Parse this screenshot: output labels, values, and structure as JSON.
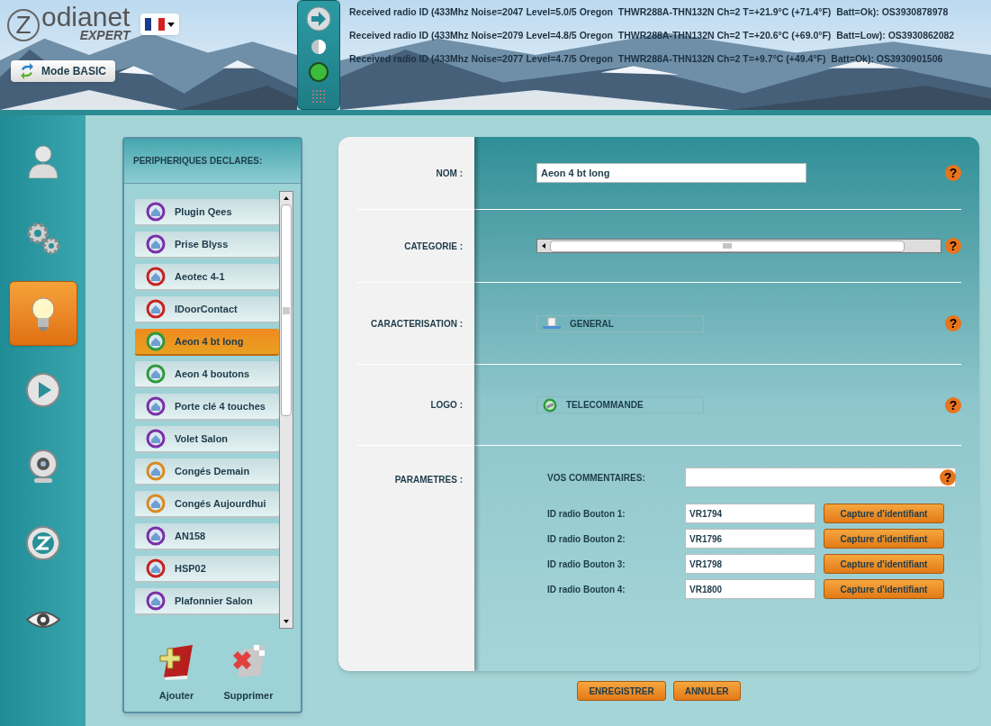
{
  "header": {
    "logo": {
      "letter": "Z",
      "name": "odianet",
      "edition": "EXPERT"
    },
    "mode_button": "Mode BASIC",
    "log_lines": [
      "Received radio ID (433Mhz Noise=2047 Level=5.0/5 Oregon  THWR288A-THN132N Ch=2 T=+21.9°C (+71.4°F)  Batt=Ok): OS3930878978",
      "Received radio ID (433Mhz Noise=2079 Level=4.8/5 Oregon  THWR288A-THN132N Ch=2 T=+20.6°C (+69.0°F)  Batt=Low): OS3930862082",
      "Received radio ID (433Mhz Noise=2077 Level=4.7/5 Oregon  THWR288A-THN132N Ch=2 T=+9.7°C (+49.4°F)  Batt=Ok): OS3930901506"
    ]
  },
  "nav": [
    {
      "kind": "user",
      "selected": false
    },
    {
      "kind": "gears",
      "selected": false
    },
    {
      "kind": "bulb",
      "selected": true
    },
    {
      "kind": "play",
      "selected": false
    },
    {
      "kind": "webcam",
      "selected": false
    },
    {
      "kind": "zlogo",
      "selected": false
    },
    {
      "kind": "eye",
      "selected": false
    }
  ],
  "devices": {
    "title": "PERIPHERIQUES DECLARES:",
    "items": [
      {
        "name": "Plugin Qees",
        "color": "#7b2fa8",
        "selected": false
      },
      {
        "name": "Prise Blyss",
        "color": "#7b2fa8",
        "selected": false
      },
      {
        "name": "Aeotec 4-1",
        "color": "#c8231e",
        "selected": false
      },
      {
        "name": "IDoorContact",
        "color": "#c8231e",
        "selected": false
      },
      {
        "name": "Aeon 4 bt long",
        "color": "#2e9a3a",
        "selected": true
      },
      {
        "name": "Aeon 4 boutons",
        "color": "#2e9a3a",
        "selected": false
      },
      {
        "name": "Porte clé 4 touches",
        "color": "#7b2fa8",
        "selected": false
      },
      {
        "name": "Volet Salon",
        "color": "#7b2fa8",
        "selected": false
      },
      {
        "name": "Congés Demain",
        "color": "#d98a1e",
        "selected": false
      },
      {
        "name": "Congés Aujourdhui",
        "color": "#d98a1e",
        "selected": false
      },
      {
        "name": "AN158",
        "color": "#7b2fa8",
        "selected": false
      },
      {
        "name": "HSP02",
        "color": "#c8231e",
        "selected": false
      },
      {
        "name": "Plafonnier Salon",
        "color": "#7b2fa8",
        "selected": false
      }
    ],
    "actions": [
      {
        "kind": "add",
        "label": "Ajouter"
      },
      {
        "kind": "delete",
        "label": "Supprimer"
      }
    ]
  },
  "form": {
    "rows": [
      {
        "kind": "text",
        "label": "NOM :",
        "value": "Aeon 4 bt long",
        "help": "?"
      },
      {
        "kind": "scroll",
        "label": "CATEGORIE :",
        "help": "?"
      },
      {
        "kind": "characterisation",
        "label": "CARACTERISATION :",
        "value": "GENERAL",
        "help": "?"
      },
      {
        "kind": "logo",
        "label": "LOGO :",
        "value": "TELECOMMANDE",
        "help": "?"
      },
      {
        "kind": "params",
        "label": "PARAMETRES :",
        "comment_label": "VOS COMMENTAIRES:",
        "help": "?",
        "ids": [
          {
            "label": "ID radio Bouton 1:",
            "value": "VR1794",
            "button": "Capture d'identifiant"
          },
          {
            "label": "ID radio Bouton 2:",
            "value": "VR1796",
            "button": "Capture d'identifiant"
          },
          {
            "label": "ID radio Bouton 3:",
            "value": "VR1798",
            "button": "Capture d'identifiant"
          },
          {
            "label": "ID radio Bouton 4:",
            "value": "VR1800",
            "button": "Capture d'identifiant"
          }
        ]
      }
    ],
    "buttons": [
      "ENREGISTRER",
      "ANNULER"
    ]
  }
}
